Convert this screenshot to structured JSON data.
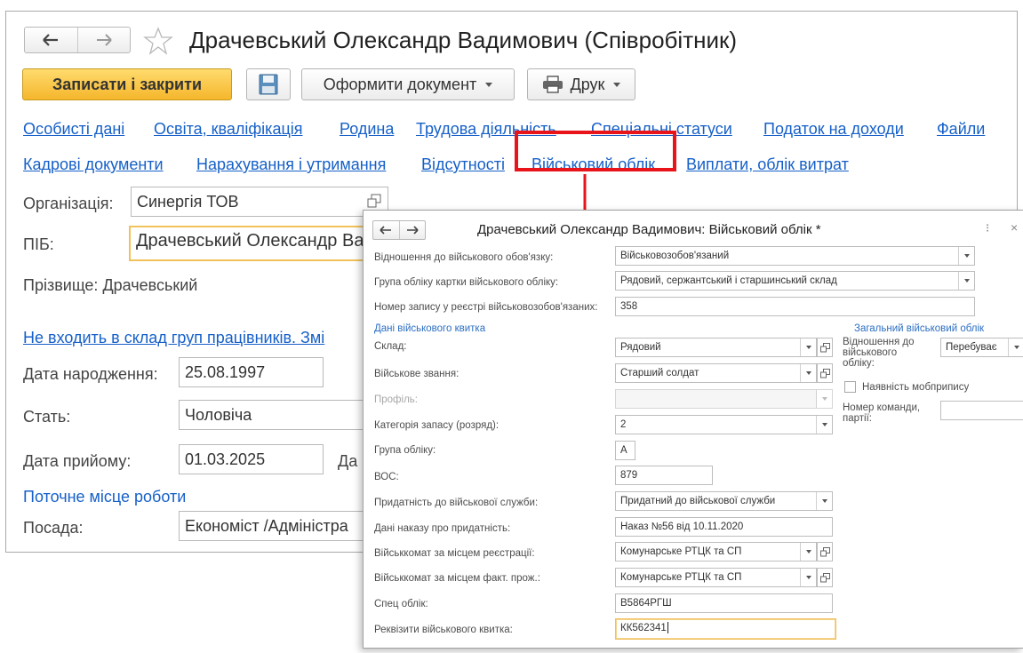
{
  "main": {
    "title": "Драчевський Олександр Вадимович (Співробітник)",
    "toolbar": {
      "save_close": "Записати і закрити",
      "issue_document": "Оформити документ",
      "print": "Друк"
    },
    "tabs_row1": [
      "Особисті дані",
      "Освіта, кваліфікація",
      "Родина",
      "Трудова діяльність",
      "Спеціальні статуси",
      "Податок на доходи",
      "Файли"
    ],
    "tabs_row2": [
      "Кадрові документи",
      "Нарахування і утримання",
      "Відсутності",
      "Військовий облік",
      "Виплати, облік витрат"
    ],
    "organization_label": "Організація:",
    "organization_value": "Синергія ТОВ",
    "pib_label": "ПІБ:",
    "pib_value": "Драчевський Олександр Ва",
    "surname_text": "Прізвище: Драчевський",
    "groups_link": "Не входить в склад груп працівників. Змі",
    "birth_label": "Дата народження:",
    "birth_value": "25.08.1997",
    "sex_label": "Стать:",
    "sex_value": "Чоловіча",
    "hire_label": "Дата прийому:",
    "hire_value": "01.03.2025",
    "hire_extra": "Да",
    "workplace_link": "Поточне місце роботи",
    "position_label": "Посада:",
    "position_value": "Економіст /Адміністра"
  },
  "dialog": {
    "title": "Драчевський Олександр Вадимович: Військовий облік *",
    "more_icon": "⁝",
    "close_icon": "×",
    "fields": {
      "relation_label": "Відношення до військового обов'язку:",
      "relation_value": "Військовозобов'язаний",
      "group_card_label": "Група обліку картки військового обліку:",
      "group_card_value": "Рядовий, сержантський і старшинський склад",
      "registry_label": "Номер запису у реєстрі військовозобов'язаних:",
      "registry_value": "358",
      "ticket_section": "Дані військового квитка",
      "composition_label": "Склад:",
      "composition_value": "Рядовий",
      "rank_label": "Військове звання:",
      "rank_value": "Старший солдат",
      "profile_label": "Профіль:",
      "reserve_label": "Категорія запасу (розряд):",
      "reserve_value": "2",
      "acc_group_label": "Група обліку:",
      "acc_group_value": "А",
      "vos_label": "ВОС:",
      "vos_value": "879",
      "fitness_label": "Придатність до військової служби:",
      "fitness_value": "Придатний до військової служби",
      "fitness_order_label": "Дані наказу про придатність:",
      "fitness_order_value": "Наказ №56 від 10.11.2020",
      "comm_reg_label": "Військкомат за місцем реєстрації:",
      "comm_reg_value": "Комунарське РТЦК та СП",
      "comm_fact_label": "Військкомат за місцем факт. прож.:",
      "comm_fact_value": "Комунарське РТЦК та СП",
      "special_label": "Спец облік:",
      "special_value": "В5864РГШ",
      "ticket_req_label": "Реквізити військового квитка:",
      "ticket_req_value": "КК562341"
    },
    "general": {
      "section": "Загальний військовий облік",
      "relation_label_1": "Відношення до",
      "relation_label_2": "військового",
      "relation_label_3": "обліку:",
      "relation_value": "Перебуває",
      "mob_label": "Наявність мобприпису",
      "team_label_1": "Номер команди,",
      "team_label_2": "партії:"
    }
  },
  "colors": {
    "link": "#1660c8",
    "primary_button": "#f5b62b",
    "highlight": "#e8141a",
    "focus": "#f1c25a"
  }
}
